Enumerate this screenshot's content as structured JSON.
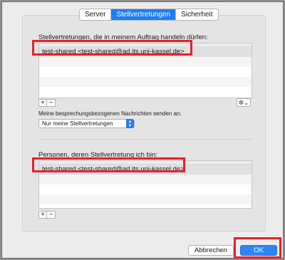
{
  "tabs": [
    {
      "label": "Server",
      "active": false
    },
    {
      "label": "Stellvertretungen",
      "active": true
    },
    {
      "label": "Sicherheit",
      "active": false
    }
  ],
  "delegates": {
    "label": "Stellvertretungen, die in meinem Auftrag handeln dürfen:",
    "rows": [
      "test-shared <test-shared@ad.its.uni-kassel.de>"
    ],
    "add_label": "+",
    "remove_label": "−",
    "gear_icon": "gear-icon",
    "gear_label": "✲⌄"
  },
  "meeting_messages": {
    "label": "Meine besprechungsbezogenen Nachrichten senden an:",
    "selected": "Nur meine Stellvertretungen"
  },
  "delegating_for": {
    "label": "Personen, deren Stellvertretung ich bin:",
    "rows": [
      "test-shared <test-shared@ad.its.uni-kassel.de>"
    ],
    "add_label": "+",
    "remove_label": "−"
  },
  "buttons": {
    "cancel": "Abbrechen",
    "ok": "OK"
  },
  "colors": {
    "accent": "#1f7ef5",
    "highlight": "#e8202a"
  }
}
